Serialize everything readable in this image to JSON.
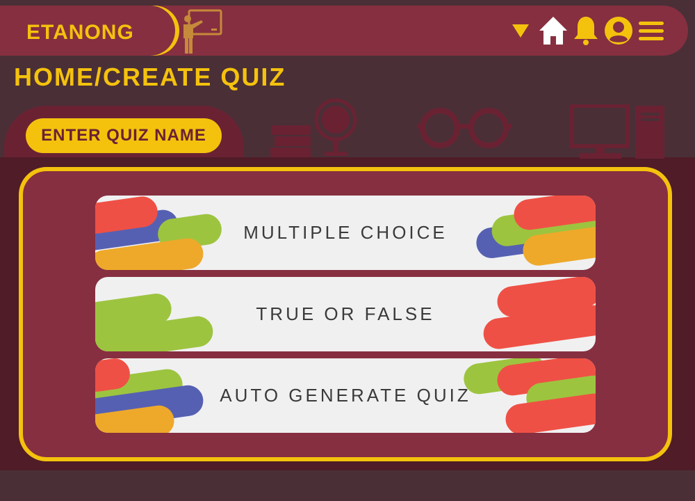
{
  "header": {
    "logo_text": "ETANONG",
    "nav": {
      "dropdown": "caret-down-icon",
      "home": "home-icon",
      "notifications": "bell-icon",
      "profile": "user-icon",
      "menu": "hamburger-icon"
    }
  },
  "page_title": "HOME/CREATE QUIZ",
  "quiz_name_button": "ENTER QUIZ NAME",
  "options": [
    {
      "label": "MULTIPLE CHOICE"
    },
    {
      "label": "TRUE OR FALSE"
    },
    {
      "label": "AUTO GENERATE QUIZ"
    }
  ],
  "colors": {
    "accent_yellow": "#f4c20d",
    "maroon": "#862f40",
    "dark_maroon": "#4f1c27",
    "card_bg": "#f0f0f1",
    "red": "#ef5045",
    "green": "#9dc43f",
    "blue": "#5660b2",
    "orange": "#eea92a"
  }
}
